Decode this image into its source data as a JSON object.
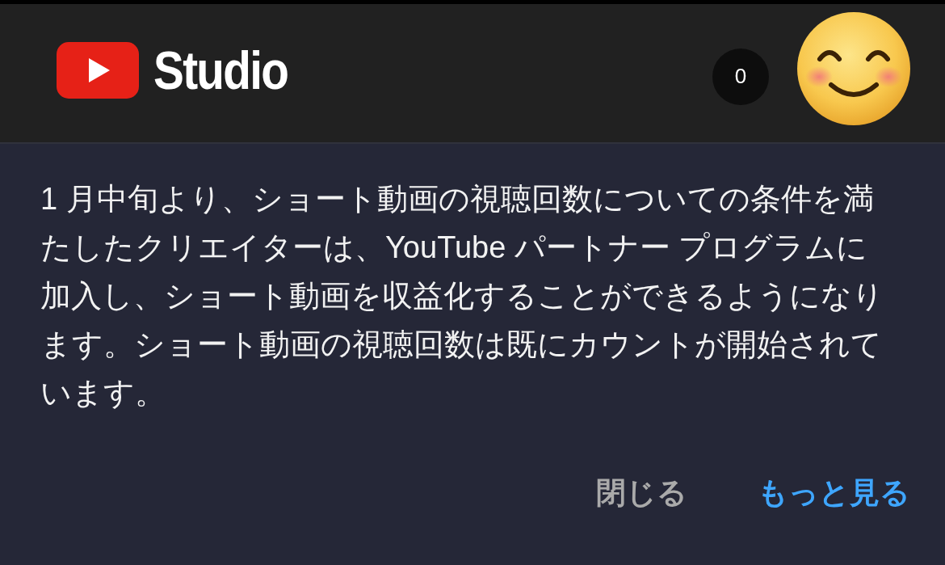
{
  "header": {
    "logo_text": "Studio",
    "count": "0"
  },
  "notice": {
    "message": "1 月中旬より、ショート動画の視聴回数についての条件を満たしたクリエイターは、YouTube パートナー プログラムに加入し、ショート動画を収益化することができるようになります。ショート動画の視聴回数は既にカウントが開始されています。",
    "actions": [
      {
        "label": "閉じる",
        "kind": "secondary"
      },
      {
        "label": "もっと見る",
        "kind": "primary"
      }
    ]
  }
}
